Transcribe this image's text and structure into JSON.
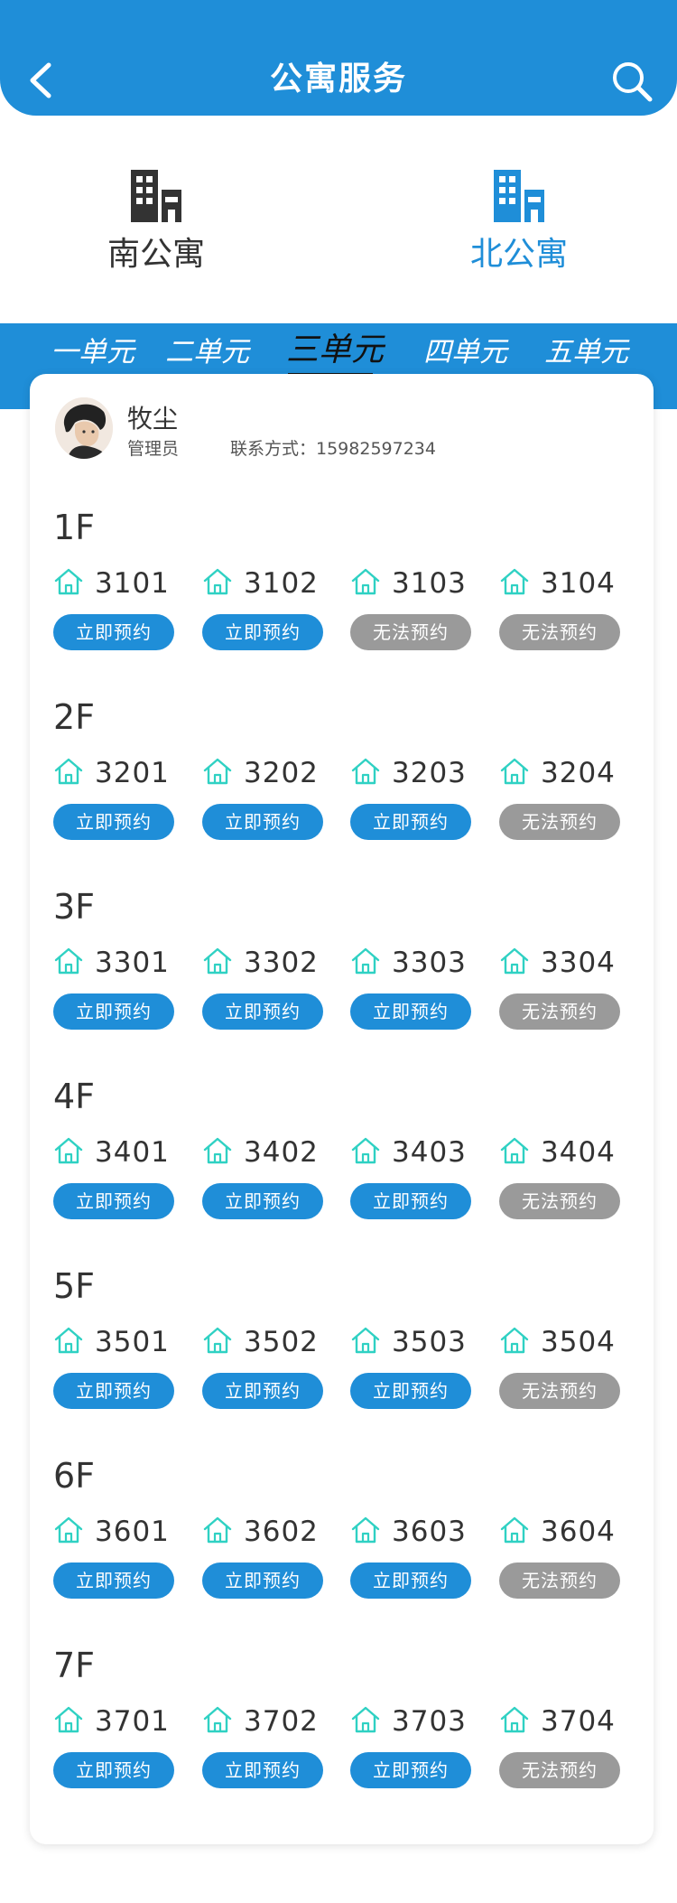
{
  "header": {
    "title": "公寓服务"
  },
  "buildings": [
    {
      "label": "南公寓",
      "active": false
    },
    {
      "label": "北公寓",
      "active": true
    }
  ],
  "tabs": [
    "一单元",
    "二单元",
    "三单元",
    "四单元",
    "五单元"
  ],
  "active_tab": "三单元",
  "manager": {
    "name": "牧尘",
    "role": "管理员",
    "contact": "联系方式：15982597234"
  },
  "labels": {
    "available": "立即预约",
    "unavailable": "无法预约"
  },
  "colors": {
    "primary": "#1f8ed8",
    "unavailable": "#9a9a9a",
    "room_icon": "#2fd1c3"
  },
  "floors": [
    {
      "label": "1F",
      "rooms": [
        {
          "num": "3101",
          "available": true
        },
        {
          "num": "3102",
          "available": true
        },
        {
          "num": "3103",
          "available": false
        },
        {
          "num": "3104",
          "available": false
        }
      ]
    },
    {
      "label": "2F",
      "rooms": [
        {
          "num": "3201",
          "available": true
        },
        {
          "num": "3202",
          "available": true
        },
        {
          "num": "3203",
          "available": true
        },
        {
          "num": "3204",
          "available": false
        }
      ]
    },
    {
      "label": "3F",
      "rooms": [
        {
          "num": "3301",
          "available": true
        },
        {
          "num": "3302",
          "available": true
        },
        {
          "num": "3303",
          "available": true
        },
        {
          "num": "3304",
          "available": false
        }
      ]
    },
    {
      "label": "4F",
      "rooms": [
        {
          "num": "3401",
          "available": true
        },
        {
          "num": "3402",
          "available": true
        },
        {
          "num": "3403",
          "available": true
        },
        {
          "num": "3404",
          "available": false
        }
      ]
    },
    {
      "label": "5F",
      "rooms": [
        {
          "num": "3501",
          "available": true
        },
        {
          "num": "3502",
          "available": true
        },
        {
          "num": "3503",
          "available": true
        },
        {
          "num": "3504",
          "available": false
        }
      ]
    },
    {
      "label": "6F",
      "rooms": [
        {
          "num": "3601",
          "available": true
        },
        {
          "num": "3602",
          "available": true
        },
        {
          "num": "3603",
          "available": true
        },
        {
          "num": "3604",
          "available": false
        }
      ]
    },
    {
      "label": "7F",
      "rooms": [
        {
          "num": "3701",
          "available": true
        },
        {
          "num": "3702",
          "available": true
        },
        {
          "num": "3703",
          "available": true
        },
        {
          "num": "3704",
          "available": false
        }
      ]
    }
  ]
}
